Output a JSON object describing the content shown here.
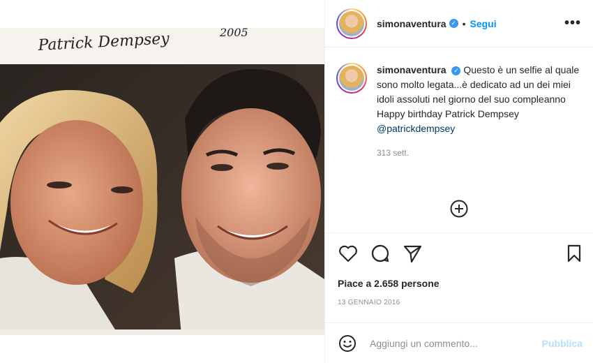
{
  "post": {
    "photo_signature": "Patrick Dempsey",
    "photo_year": "2005",
    "author": {
      "username": "simonaventura",
      "verified_icon": "verified-badge-icon",
      "follow_label": "Segui",
      "separator": "•"
    },
    "more_icon": "more-options-icon",
    "caption": {
      "line1": "Questo è un selfie al quale sono molto legata...è dedicato ad un dei miei idoli assoluti nel giorno del suo compleanno",
      "line2": "Happy birthday Patrick Dempsey",
      "mention": "@patrickdempsey",
      "time_ago": "313 sett."
    },
    "likes_text": "Piace a 2.658 persone",
    "date": "13 GENNAIO 2016",
    "comment": {
      "placeholder": "Aggiungi un commento...",
      "publish_label": "Pubblica"
    },
    "colors": {
      "link_blue": "#0095f6",
      "publish_disabled": "#b2dffc",
      "verified": "#3897f0",
      "muted": "#8e8e8e"
    }
  }
}
